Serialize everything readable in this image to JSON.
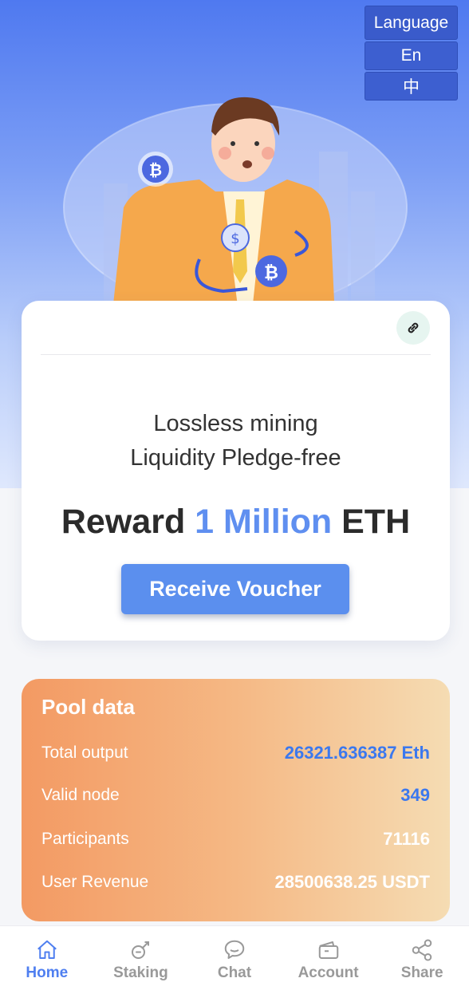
{
  "language": {
    "title": "Language",
    "options": [
      "En",
      "中"
    ]
  },
  "hero": {
    "tagline_line1": "Lossless mining",
    "tagline_line2": "Liquidity Pledge-free",
    "reward_prefix": "Reward",
    "reward_amount": "1 Million",
    "reward_suffix": "ETH",
    "button_label": "Receive Voucher"
  },
  "pool": {
    "title": "Pool data",
    "rows": [
      {
        "label": "Total output",
        "value": "26321.636387 Eth"
      },
      {
        "label": "Valid node",
        "value": "349"
      },
      {
        "label": "Participants",
        "value": "71116"
      },
      {
        "label": "User Revenue",
        "value": "28500638.25 USDT"
      }
    ]
  },
  "tabs": [
    {
      "label": "Home",
      "icon": "home-icon",
      "active": true
    },
    {
      "label": "Staking",
      "icon": "staking-icon"
    },
    {
      "label": "Chat",
      "icon": "chat-icon"
    },
    {
      "label": "Account",
      "icon": "wallet-icon"
    },
    {
      "label": "Share",
      "icon": "share-icon"
    }
  ],
  "colors": {
    "accent": "#5b8fee",
    "pool_start": "#f39a63",
    "pool_end": "#f5dcb3"
  }
}
